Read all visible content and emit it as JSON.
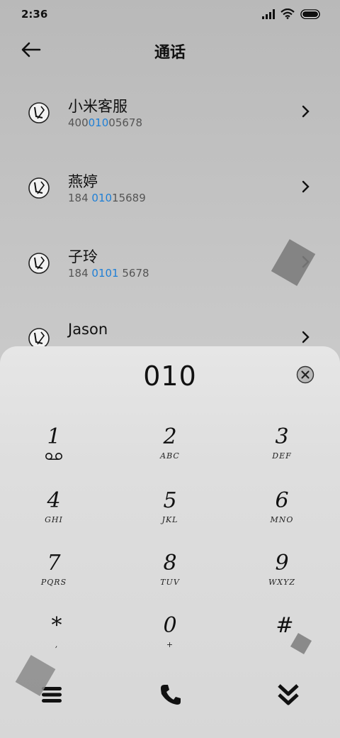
{
  "status": {
    "time": "2:36"
  },
  "header": {
    "title": "通话"
  },
  "contacts": [
    {
      "name": "小米客服",
      "num_pre": "400",
      "num_hl": "010",
      "num_post": "05678"
    },
    {
      "name": "燕婷",
      "num_pre": "184 ",
      "num_hl": "010",
      "num_post": "15689"
    },
    {
      "name": "子玲",
      "num_pre": "184 ",
      "num_hl": "0101",
      "num_post": " 5678"
    },
    {
      "name": "Jason",
      "num_pre": "",
      "num_hl": "",
      "num_post": ""
    }
  ],
  "dialer": {
    "input": "010",
    "keys": [
      {
        "digit": "1",
        "letters": ""
      },
      {
        "digit": "2",
        "letters": "ABC"
      },
      {
        "digit": "3",
        "letters": "DEF"
      },
      {
        "digit": "4",
        "letters": "GHI"
      },
      {
        "digit": "5",
        "letters": "JKL"
      },
      {
        "digit": "6",
        "letters": "MNO"
      },
      {
        "digit": "7",
        "letters": "PQRS"
      },
      {
        "digit": "8",
        "letters": "TUV"
      },
      {
        "digit": "9",
        "letters": "WXYZ"
      },
      {
        "digit": "*",
        "letters": ","
      },
      {
        "digit": "0",
        "letters": "+"
      },
      {
        "digit": "#",
        "letters": ""
      }
    ]
  },
  "icons": {
    "back": "arrow-left-icon",
    "avatar": "contact-avatar-icon",
    "chevron": "chevron-right-icon",
    "clear": "clear-input-icon",
    "voicemail": "voicemail-icon",
    "menu": "menu-icon",
    "call": "phone-icon",
    "collapse": "collapse-keypad-icon"
  },
  "colors": {
    "highlight": "#1e7fd6"
  }
}
